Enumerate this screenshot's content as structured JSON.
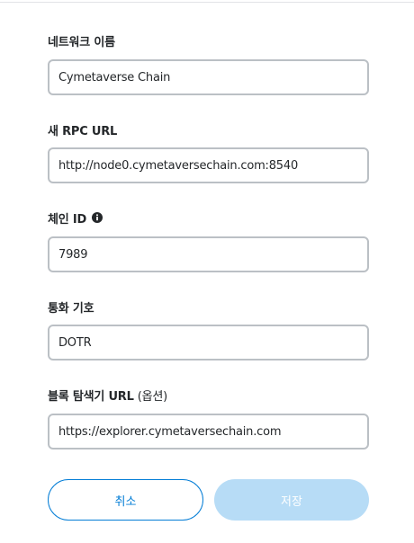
{
  "form": {
    "network_name": {
      "label": "네트워크 이름",
      "value": "Cymetaverse Chain"
    },
    "rpc_url": {
      "label": "새 RPC URL",
      "value": "http://node0.cymetaversechain.com:8540"
    },
    "chain_id": {
      "label": "체인 ID",
      "value": "7989",
      "info_icon": "info-icon"
    },
    "currency_symbol": {
      "label": "통화 기호",
      "value": "DOTR"
    },
    "explorer_url": {
      "label": "블록 탐색기 URL",
      "optional_label": "(옵션)",
      "value": "https://explorer.cymetaversechain.com"
    }
  },
  "buttons": {
    "cancel_label": "취소",
    "save_label": "저장",
    "save_disabled": true
  },
  "colors": {
    "primary": "#037dd6",
    "primary_disabled": "#b7dcf6",
    "input_border": "#bbc0c5",
    "text": "#24272a"
  }
}
